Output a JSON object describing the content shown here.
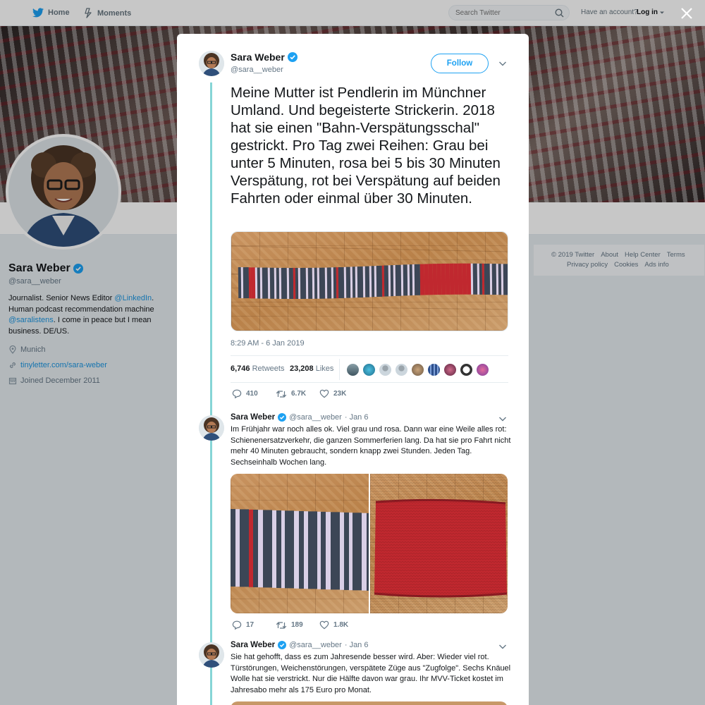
{
  "topbar": {
    "home_label": "Home",
    "moments_label": "Moments",
    "search_placeholder": "Search Twitter",
    "have_account": "Have an account?",
    "login_label": "Log in"
  },
  "profile": {
    "name": "Sara Weber",
    "handle": "@sara__weber",
    "bio_1": "Journalist. Senior News Editor ",
    "bio_link_1": "@LinkedIn",
    "bio_2": ". Human podcast recommendation machine ",
    "bio_link_2": "@saralistens",
    "bio_3": ". I come in peace but I mean business. DE/US.",
    "location": "Munich",
    "url": "tinyletter.com/sara-weber",
    "joined": "Joined December 2011"
  },
  "footer": {
    "row1": [
      "© 2019 Twitter",
      "About",
      "Help Center",
      "Terms"
    ],
    "row2": [
      "Privacy policy",
      "Cookies",
      "Ads info"
    ]
  },
  "main_tweet": {
    "name": "Sara Weber",
    "handle": "@sara__weber",
    "follow_label": "Follow",
    "text": "Meine Mutter ist Pendlerin im Münchner Umland. Und begeisterte Strickerin. 2018 hat sie einen \"Bahn-Verspätungsschal\" gestrickt. Pro Tag zwei Reihen: Grau bei unter 5 Minuten, rosa bei 5 bis 30 Minuten Verspätung, rot bei Verspätung auf beiden Fahrten oder einmal über 30 Minuten.",
    "timestamp": "8:29 AM - 6 Jan 2019",
    "retweets_count": "6,746",
    "retweets_label": "Retweets",
    "likes_count": "23,208",
    "likes_label": "Likes",
    "replies": "410",
    "retweets_short": "6.7K",
    "likes_short": "23K"
  },
  "replies": [
    {
      "name": "Sara Weber",
      "handle": "@sara__weber",
      "date": "· Jan 6",
      "text": "Im Frühjahr war noch alles ok. Viel grau und rosa. Dann war eine Weile alles rot: Schienenersatzverkehr, die ganzen Sommerferien lang. Da hat sie pro Fahrt nicht mehr 40 Minuten gebraucht, sondern knapp zwei Stunden. Jeden Tag. Sechseinhalb Wochen lang.",
      "replies": "17",
      "retweets": "189",
      "likes": "1.8K"
    },
    {
      "name": "Sara Weber",
      "handle": "@sara__weber",
      "date": "· Jan 6",
      "text": "Sie hat gehofft, dass es zum Jahresende besser wird. Aber: Wieder viel rot. Türstörungen, Weichenstörungen, verspätete Züge aus \"Zugfolge\". Sechs Knäuel Wolle hat sie verstrickt. Nur die Hälfte davon war grau. Ihr MVV-Ticket kostet im Jahresabo mehr als 175 Euro pro Monat."
    }
  ],
  "colors": {
    "accent": "#1da1f2",
    "thread_line": "#86d5d6",
    "scarf_grey": "#3c4656",
    "scarf_pink": "#d9cfe6",
    "scarf_red": "#c0282f"
  },
  "icons": [
    "twitter-bird-icon",
    "moments-icon",
    "search-icon",
    "close-icon",
    "verified-icon",
    "chevron-down-icon",
    "reply-icon",
    "retweet-icon",
    "heart-icon",
    "location-icon",
    "link-icon",
    "calendar-icon"
  ]
}
